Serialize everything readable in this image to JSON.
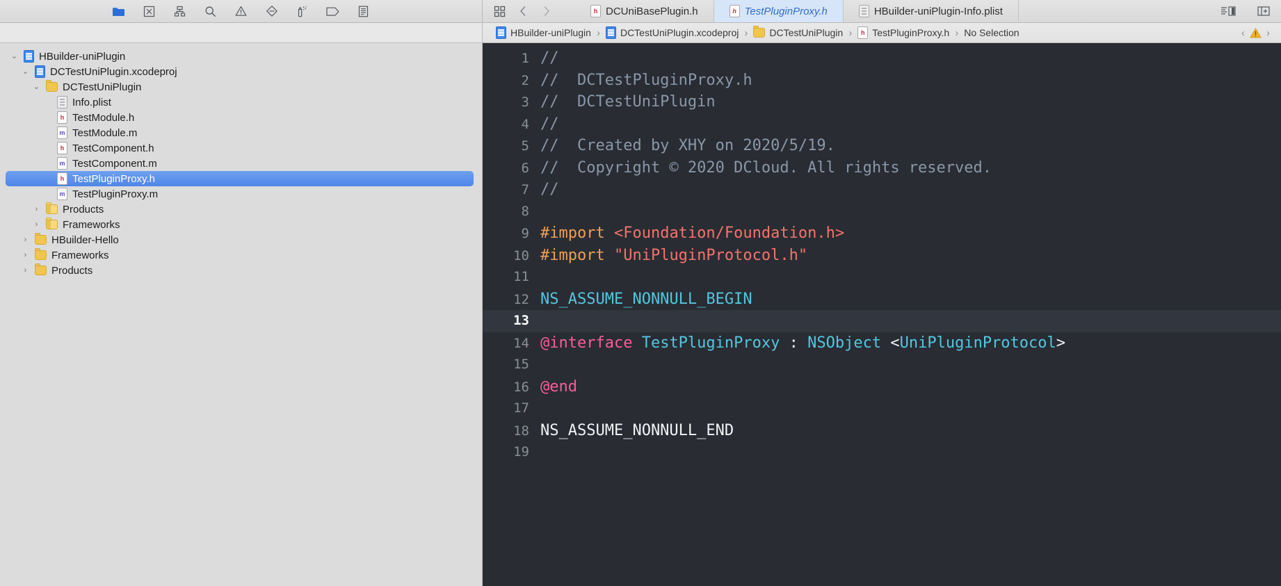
{
  "navigator_toolbar": {
    "icons": [
      {
        "name": "project-navigator-icon",
        "glyph": "folder",
        "active": true
      },
      {
        "name": "source-control-navigator-icon",
        "glyph": "x-box",
        "active": false
      },
      {
        "name": "symbol-navigator-icon",
        "glyph": "hierarchy",
        "active": false
      },
      {
        "name": "find-navigator-icon",
        "glyph": "search",
        "active": false
      },
      {
        "name": "issue-navigator-icon",
        "glyph": "warning-triangle",
        "active": false
      },
      {
        "name": "test-navigator-icon",
        "glyph": "diamond",
        "active": false
      },
      {
        "name": "debug-navigator-icon",
        "glyph": "spray",
        "active": false
      },
      {
        "name": "breakpoint-navigator-icon",
        "glyph": "tag",
        "active": false
      },
      {
        "name": "report-navigator-icon",
        "glyph": "report",
        "active": false
      }
    ]
  },
  "tree": [
    {
      "label": "HBuilder-uniPlugin",
      "indent": 0,
      "twist": "⌄",
      "icon": "proj",
      "selected": false
    },
    {
      "label": "DCTestUniPlugin.xcodeproj",
      "indent": 1,
      "twist": "⌄",
      "icon": "proj",
      "selected": false
    },
    {
      "label": "DCTestUniPlugin",
      "indent": 2,
      "twist": "⌄",
      "icon": "folder",
      "selected": false
    },
    {
      "label": "Info.plist",
      "indent": 3,
      "twist": "",
      "icon": "plist",
      "selected": false
    },
    {
      "label": "TestModule.h",
      "indent": 3,
      "twist": "",
      "icon": "h",
      "selected": false
    },
    {
      "label": "TestModule.m",
      "indent": 3,
      "twist": "",
      "icon": "m",
      "selected": false
    },
    {
      "label": "TestComponent.h",
      "indent": 3,
      "twist": "",
      "icon": "h",
      "selected": false
    },
    {
      "label": "TestComponent.m",
      "indent": 3,
      "twist": "",
      "icon": "m",
      "selected": false
    },
    {
      "label": "TestPluginProxy.h",
      "indent": 3,
      "twist": "",
      "icon": "h",
      "selected": true
    },
    {
      "label": "TestPluginProxy.m",
      "indent": 3,
      "twist": "",
      "icon": "m",
      "selected": false
    },
    {
      "label": "Products",
      "indent": 2,
      "twist": "›",
      "icon": "folder-light",
      "selected": false
    },
    {
      "label": "Frameworks",
      "indent": 2,
      "twist": "›",
      "icon": "folder-light",
      "selected": false
    },
    {
      "label": "HBuilder-Hello",
      "indent": 1,
      "twist": "›",
      "icon": "folder",
      "selected": false
    },
    {
      "label": "Frameworks",
      "indent": 1,
      "twist": "›",
      "icon": "folder",
      "selected": false
    },
    {
      "label": "Products",
      "indent": 1,
      "twist": "›",
      "icon": "folder",
      "selected": false
    }
  ],
  "editor_tabbar": {
    "left_icons": [
      {
        "name": "editor-options-icon",
        "glyph": "grid"
      },
      {
        "name": "navigate-back-icon",
        "glyph": "chevron-left"
      },
      {
        "name": "navigate-forward-icon",
        "glyph": "chevron-right"
      }
    ],
    "tabs": [
      {
        "label": "DCUniBasePlugin.h",
        "icon": "h",
        "active": false
      },
      {
        "label": "TestPluginProxy.h",
        "icon": "h",
        "active": true
      },
      {
        "label": "HBuilder-uniPlugin-Info.plist",
        "icon": "plist",
        "active": false
      }
    ],
    "right_icons": [
      {
        "name": "standard-editor-icon",
        "glyph": "editor-panes"
      },
      {
        "name": "add-editor-icon",
        "glyph": "add-pane"
      }
    ]
  },
  "breadcrumb": {
    "crumbs": [
      {
        "label": "HBuilder-uniPlugin",
        "icon": "proj"
      },
      {
        "label": "DCTestUniPlugin.xcodeproj",
        "icon": "proj"
      },
      {
        "label": "DCTestUniPlugin",
        "icon": "folder"
      },
      {
        "label": "TestPluginProxy.h",
        "icon": "h"
      },
      {
        "label": "No Selection",
        "icon": ""
      }
    ],
    "separator": "›",
    "prev_issue": "‹",
    "next_issue": "›",
    "issue_icon": "warning-triangle-icon"
  },
  "code": {
    "current_line": 13,
    "lines": [
      {
        "n": 1,
        "tokens": [
          {
            "t": "//",
            "c": "cm"
          }
        ]
      },
      {
        "n": 2,
        "tokens": [
          {
            "t": "//  DCTestPluginProxy.h",
            "c": "cm"
          }
        ]
      },
      {
        "n": 3,
        "tokens": [
          {
            "t": "//  DCTestUniPlugin",
            "c": "cm"
          }
        ]
      },
      {
        "n": 4,
        "tokens": [
          {
            "t": "//",
            "c": "cm"
          }
        ]
      },
      {
        "n": 5,
        "tokens": [
          {
            "t": "//  Created by XHY on 2020/5/19.",
            "c": "cm"
          }
        ]
      },
      {
        "n": 6,
        "tokens": [
          {
            "t": "//  Copyright © 2020 DCloud. All rights reserved.",
            "c": "cm"
          }
        ]
      },
      {
        "n": 7,
        "tokens": [
          {
            "t": "//",
            "c": "cm"
          }
        ]
      },
      {
        "n": 8,
        "tokens": []
      },
      {
        "n": 9,
        "tokens": [
          {
            "t": "#import ",
            "c": "pp"
          },
          {
            "t": "<Foundation/Foundation.h>",
            "c": "str"
          }
        ]
      },
      {
        "n": 10,
        "tokens": [
          {
            "t": "#import ",
            "c": "pp"
          },
          {
            "t": "\"UniPluginProtocol.h\"",
            "c": "str"
          }
        ]
      },
      {
        "n": 11,
        "tokens": []
      },
      {
        "n": 12,
        "tokens": [
          {
            "t": "NS_ASSUME_NONNULL_BEGIN",
            "c": "mac"
          }
        ]
      },
      {
        "n": 13,
        "tokens": []
      },
      {
        "n": 14,
        "tokens": [
          {
            "t": "@interface ",
            "c": "kw"
          },
          {
            "t": "TestPluginProxy",
            "c": "mac"
          },
          {
            "t": " : ",
            "c": "plain"
          },
          {
            "t": "NSObject ",
            "c": "mac"
          },
          {
            "t": "<",
            "c": "plain"
          },
          {
            "t": "UniPluginProtocol",
            "c": "mac"
          },
          {
            "t": ">",
            "c": "plain"
          }
        ]
      },
      {
        "n": 15,
        "tokens": []
      },
      {
        "n": 16,
        "tokens": [
          {
            "t": "@end",
            "c": "kw"
          }
        ]
      },
      {
        "n": 17,
        "tokens": []
      },
      {
        "n": 18,
        "tokens": [
          {
            "t": "NS_ASSUME_NONNULL_END",
            "c": "plain"
          }
        ]
      },
      {
        "n": 19,
        "tokens": []
      }
    ]
  },
  "colors": {
    "selection_blue": "#4f86e8",
    "active_tab_bg": "#d6e5f7",
    "editor_bg": "#292c33",
    "current_line_bg": "#32363e"
  }
}
